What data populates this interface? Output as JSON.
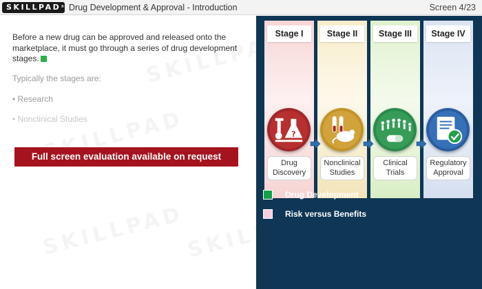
{
  "header": {
    "logo_text": "SKILLPAD",
    "logo_mark": "®",
    "title": "Drug Development & Approval - Introduction",
    "screen_label": "Screen 4/23"
  },
  "content": {
    "intro": "Before a new drug can be approved and released onto the marketplace, it must go through a series of drug development stages.",
    "typically": "Typically the stages are:",
    "bullets": [
      "• Research",
      "• Nonclinical Studies"
    ],
    "eval_button": "Full screen evaluation available on request"
  },
  "watermark_text": "SKILLPAD",
  "diagram": {
    "stages": [
      {
        "label": "Stage I",
        "name_line1": "Drug",
        "name_line2": "Discovery",
        "icon": "lab-flask-icon",
        "color": "#a3262a"
      },
      {
        "label": "Stage II",
        "name_line1": "Nonclinical",
        "name_line2": "Studies",
        "icon": "lab-mouse-icon",
        "color": "#c99a2b"
      },
      {
        "label": "Stage III",
        "name_line1": "Clinical",
        "name_line2": "Trials",
        "icon": "people-pill-icon",
        "color": "#2f9452"
      },
      {
        "label": "Stage IV",
        "name_line1": "Regulatory",
        "name_line2": "Approval",
        "icon": "approved-document-icon",
        "color": "#2c62a8"
      }
    ],
    "legend": [
      {
        "label": "Drug Development",
        "color": "#13a04a"
      },
      {
        "label": "Risk versus Benefits",
        "color": "#f7cfdf"
      }
    ]
  }
}
